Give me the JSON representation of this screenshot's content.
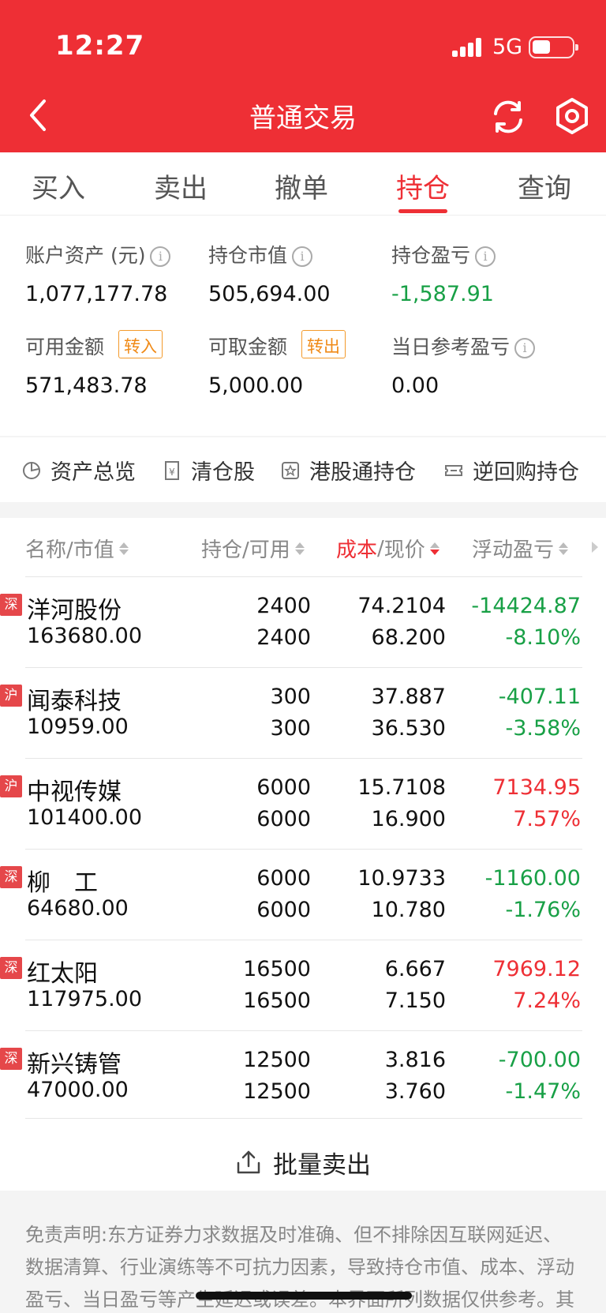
{
  "status_bar": {
    "time": "12:27",
    "network": "5G"
  },
  "header": {
    "title": "普通交易"
  },
  "tabs": [
    {
      "label": "买入"
    },
    {
      "label": "卖出"
    },
    {
      "label": "撤单"
    },
    {
      "label": "持仓",
      "active": true
    },
    {
      "label": "查询"
    }
  ],
  "summary": {
    "account_assets": {
      "label": "账户资产 (元)",
      "value": "1,077,177.78"
    },
    "position_value": {
      "label": "持仓市值",
      "value": "505,694.00"
    },
    "position_pnl": {
      "label": "持仓盈亏",
      "value": "-1,587.91"
    },
    "available": {
      "label": "可用金额",
      "value": "571,483.78",
      "action": "转入"
    },
    "withdrawable": {
      "label": "可取金额",
      "value": "5,000.00",
      "action": "转出"
    },
    "daily_pnl": {
      "label": "当日参考盈亏",
      "value": "0.00"
    }
  },
  "quick_links": [
    {
      "label": "资产总览",
      "icon": "pie-chart-icon"
    },
    {
      "label": "清仓股",
      "icon": "yen-receipt-icon"
    },
    {
      "label": "港股通持仓",
      "icon": "star-box-icon"
    },
    {
      "label": "逆回购持仓",
      "icon": "ticket-icon"
    }
  ],
  "table": {
    "headers": {
      "name": "名称/市值",
      "qty": "持仓/可用",
      "cost_a": "成本",
      "cost_sep": "/",
      "cost_b": "现价",
      "pnl": "浮动盈亏"
    },
    "rows": [
      {
        "market": "深",
        "name": "洋河股份",
        "market_value": "163680.00",
        "hold": "2400",
        "avail": "2400",
        "cost": "74.2104",
        "price": "68.200",
        "pnl": "-14424.87",
        "pnl_pct": "-8.10%",
        "direction": "down"
      },
      {
        "market": "沪",
        "name": "闻泰科技",
        "market_value": "10959.00",
        "hold": "300",
        "avail": "300",
        "cost": "37.887",
        "price": "36.530",
        "pnl": "-407.11",
        "pnl_pct": "-3.58%",
        "direction": "down"
      },
      {
        "market": "沪",
        "name": "中视传媒",
        "market_value": "101400.00",
        "hold": "6000",
        "avail": "6000",
        "cost": "15.7108",
        "price": "16.900",
        "pnl": "7134.95",
        "pnl_pct": "7.57%",
        "direction": "up"
      },
      {
        "market": "深",
        "name": "柳　工",
        "market_value": "64680.00",
        "hold": "6000",
        "avail": "6000",
        "cost": "10.9733",
        "price": "10.780",
        "pnl": "-1160.00",
        "pnl_pct": "-1.76%",
        "direction": "down"
      },
      {
        "market": "深",
        "name": "红太阳",
        "market_value": "117975.00",
        "hold": "16500",
        "avail": "16500",
        "cost": "6.667",
        "price": "7.150",
        "pnl": "7969.12",
        "pnl_pct": "7.24%",
        "direction": "up"
      },
      {
        "market": "深",
        "name": "新兴铸管",
        "market_value": "47000.00",
        "hold": "12500",
        "avail": "12500",
        "cost": "3.816",
        "price": "3.760",
        "pnl": "-700.00",
        "pnl_pct": "-1.47%",
        "direction": "down"
      }
    ]
  },
  "bulk_sell": {
    "label": "批量卖出"
  },
  "disclaimer": "免责声明:东方证券力求数据及时准确、但不排除因互联网延迟、数据清算、行业演练等不可抗力因素，导致持仓市值、成本、浮动盈亏、当日盈亏等产生延迟或误差。本界面所列数据仅供参考。其中港股通持仓数据中如果有HK$货币标识符，说明以港币",
  "colors": {
    "brand_red": "#ee2f35",
    "loss_green": "#18a046",
    "tag_orange": "#f08a17"
  }
}
